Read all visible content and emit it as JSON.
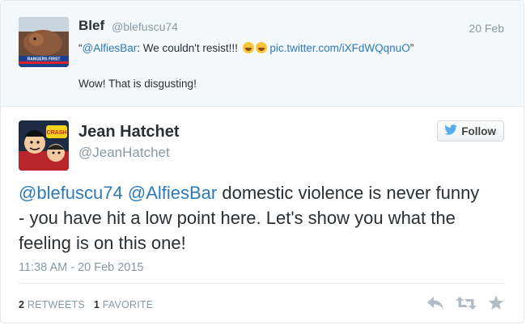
{
  "parent_tweet": {
    "name": "Blef",
    "handle": "@blefuscu74",
    "date": "20 Feb",
    "quote_open": "“",
    "mention": "@AlfiesBar",
    "quote_text": ": We couldn't resist!!! ",
    "emojis": [
      "joy-emoji",
      "joy-emoji"
    ],
    "pic_link": "pic.twitter.com/iXFdWQqnuO",
    "quote_close": "”",
    "reply_text": "Wow! That is disgusting!",
    "avatar_caption": "RANGERS FIRST"
  },
  "main_tweet": {
    "name": "Jean Hatchet",
    "handle": "@JeanHatchet",
    "follow_label": "Follow",
    "mention_1": "@blefuscu74",
    "mention_2": "@AlfiesBar",
    "text_rest": " domestic violence is never funny - you have hit a low point here. Let's show you what the feeling is on this one!",
    "timestamp": "11:38 AM - 20 Feb 2015",
    "retweets_count": "2",
    "retweets_label": "RETWEETS",
    "favorites_count": "1",
    "favorites_label": "FAVORITE",
    "avatar_text": "CRASH"
  },
  "icons": {
    "follow": "twitter-bird-icon",
    "reply": "reply-icon",
    "retweet": "retweet-icon",
    "favorite": "star-icon"
  },
  "colors": {
    "link": "#2b7bb9",
    "muted": "#8899a6",
    "text": "#292f33",
    "bird": "#55acee",
    "parent_bg": "#f5f8fa"
  }
}
